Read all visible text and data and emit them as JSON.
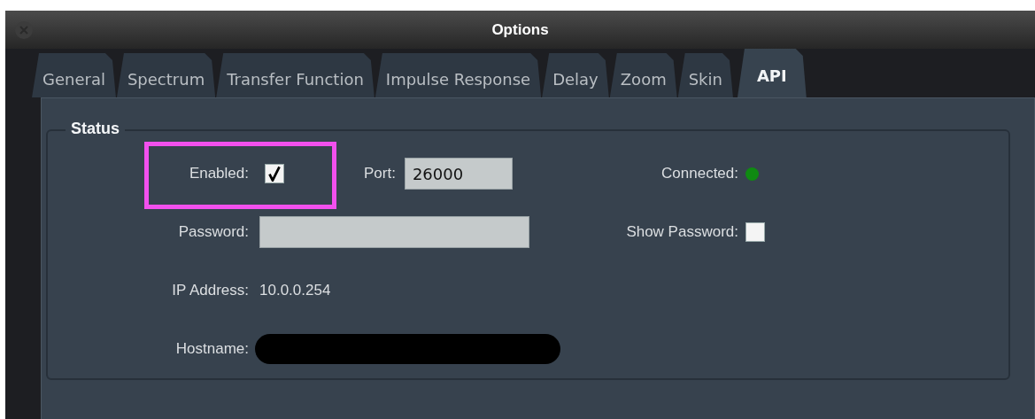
{
  "window": {
    "title": "Options"
  },
  "tabs": [
    {
      "label": "General",
      "selected": false
    },
    {
      "label": "Spectrum",
      "selected": false
    },
    {
      "label": "Transfer Function",
      "selected": false
    },
    {
      "label": "Impulse Response",
      "selected": false
    },
    {
      "label": "Delay",
      "selected": false
    },
    {
      "label": "Zoom",
      "selected": false
    },
    {
      "label": "Skin",
      "selected": false
    },
    {
      "label": "API",
      "selected": true
    }
  ],
  "status": {
    "title": "Status",
    "enabled": {
      "label": "Enabled:",
      "checked": true,
      "highlighted": true
    },
    "port": {
      "label": "Port:",
      "value": "26000"
    },
    "connected": {
      "label": "Connected:",
      "on": true
    },
    "password": {
      "label": "Password:"
    },
    "show_password": {
      "label": "Show Password:",
      "checked": false
    },
    "ip_address": {
      "label": "IP Address:",
      "value": "10.0.0.254"
    },
    "hostname": {
      "label": "Hostname:",
      "redacted": true
    }
  }
}
